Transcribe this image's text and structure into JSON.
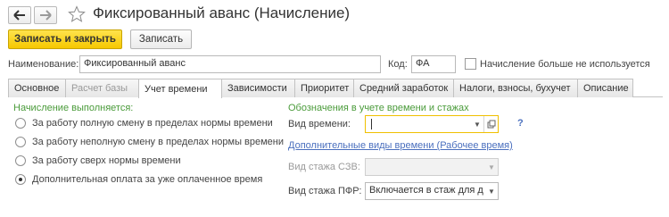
{
  "window": {
    "title": "Фиксированный аванс (Начисление)"
  },
  "toolbar": {
    "save_close_label": "Записать и закрыть",
    "save_label": "Записать"
  },
  "header": {
    "name_label": "Наименование:",
    "name_value": "Фиксированный аванс",
    "code_label": "Код:",
    "code_value": "ФА",
    "not_used_label": "Начисление больше не используется",
    "not_used_checked": false
  },
  "tabs": [
    {
      "label": "Основное",
      "state": "normal"
    },
    {
      "label": "Расчет базы",
      "state": "disabled"
    },
    {
      "label": "Учет времени",
      "state": "active"
    },
    {
      "label": "Зависимости",
      "state": "normal"
    },
    {
      "label": "Приоритет",
      "state": "normal"
    },
    {
      "label": "Средний заработок",
      "state": "normal"
    },
    {
      "label": "Налоги, взносы, бухучет",
      "state": "normal"
    },
    {
      "label": "Описание",
      "state": "normal"
    }
  ],
  "left": {
    "section_title": "Начисление выполняется:",
    "options": [
      {
        "label": "За работу полную смену в пределах нормы времени",
        "checked": false
      },
      {
        "label": "За работу неполную смену в пределах нормы времени",
        "checked": false
      },
      {
        "label": "За работу сверх нормы времени",
        "checked": false
      },
      {
        "label": "Дополнительная оплата за уже оплаченное время",
        "checked": true
      }
    ]
  },
  "right": {
    "section_title": "Обозначения в учете времени и стажах",
    "time_type_label": "Вид времени:",
    "time_type_value": "",
    "help_mark": "?",
    "extra_types_link": "Дополнительные виды времени (Рабочее время)",
    "szv_label": "Вид стажа СЗВ:",
    "szv_value": "",
    "pfr_label": "Вид стажа ПФР:",
    "pfr_value": "Включается в стаж для д"
  },
  "colors": {
    "accent_yellow": "#f6c800",
    "section_green": "#4a9b3a",
    "link_blue": "#4a6fbe",
    "focus_border": "#f0c000"
  },
  "icons": {
    "back": "arrow-left-icon",
    "forward": "arrow-right-icon",
    "favorite": "star-icon",
    "dropdown": "chevron-down-icon",
    "open": "open-form-icon"
  }
}
